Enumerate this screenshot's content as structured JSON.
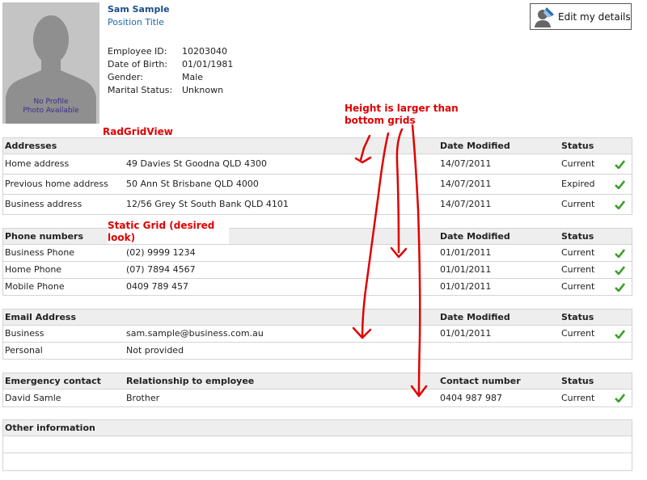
{
  "profile": {
    "name": "Sam Sample",
    "position_title": "Position Title",
    "photo_placeholder": "No Profile Photo Available",
    "photo_placeholder_line1": "No Profile",
    "photo_placeholder_line2": "Photo Available",
    "fields": [
      {
        "label": "Employee ID:",
        "value": "10203040"
      },
      {
        "label": "Date of Birth:",
        "value": "01/01/1981"
      },
      {
        "label": "Gender:",
        "value": "Male"
      },
      {
        "label": "Marital Status:",
        "value": "Unknown"
      }
    ]
  },
  "edit_button": {
    "label": "Edit my details",
    "icon": "person-edit-icon"
  },
  "annotations": {
    "height_note_line1": "Height is larger than",
    "height_note_line2": "bottom grids",
    "radgridview": "RadGridView",
    "static_grid_line1": "Static Grid (desired",
    "static_grid_line2": "look)",
    "color": "#e00000"
  },
  "addresses": {
    "headers": [
      "Addresses",
      "",
      "Date Modified",
      "Status"
    ],
    "rows": [
      {
        "type": "Home address",
        "value": "49 Davies St Goodna QLD 4300",
        "date": "14/07/2011",
        "status": "Current"
      },
      {
        "type": "Previous home address",
        "value": "50 Ann St Brisbane QLD 4000",
        "date": "14/07/2011",
        "status": "Expired"
      },
      {
        "type": "Business address",
        "value": "12/56 Grey St South Bank QLD 4101",
        "date": "14/07/2011",
        "status": "Current"
      }
    ]
  },
  "phones": {
    "headers": [
      "Phone numbers",
      "",
      "Date Modified",
      "Status"
    ],
    "rows": [
      {
        "type": "Business Phone",
        "value": "(02) 9999 1234",
        "date": "01/01/2011",
        "status": "Current"
      },
      {
        "type": "Home Phone",
        "value": "(07) 7894 4567",
        "date": "01/01/2011",
        "status": "Current"
      },
      {
        "type": "Mobile Phone",
        "value": "0409 789 457",
        "date": "01/01/2011",
        "status": "Current"
      }
    ]
  },
  "emails": {
    "headers": [
      "Email Address",
      "",
      "Date Modified",
      "Status"
    ],
    "rows": [
      {
        "type": "Business",
        "value": "sam.sample@business.com.au",
        "date": "01/01/2011",
        "status": "Current"
      },
      {
        "type": "Personal",
        "value": "Not provided",
        "date": "",
        "status": ""
      }
    ]
  },
  "emergency": {
    "headers": [
      "Emergency contact",
      "Relationship to employee",
      "Contact number",
      "Status"
    ],
    "rows": [
      {
        "type": "David Samle",
        "value": "Brother",
        "date": "0404 987 987",
        "status": "Current"
      }
    ]
  },
  "other": {
    "headers": [
      "Other information"
    ]
  },
  "colors": {
    "check": "#3aa02a",
    "header_bg": "#eeeeee",
    "border": "#d4d4d4",
    "link": "#1a4e8a"
  }
}
